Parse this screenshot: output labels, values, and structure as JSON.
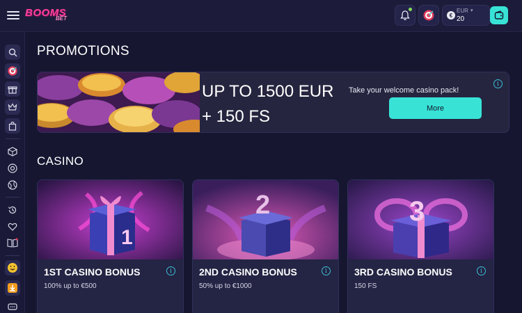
{
  "header": {
    "logo_text": "BOOMS",
    "logo_sub": "BET",
    "currency": "EUR",
    "currency_symbol": "€",
    "balance": "20"
  },
  "sidebar": {
    "items": [
      "search-icon",
      "target-icon",
      "gift-icon",
      "crown-icon",
      "bag-icon",
      "dice-icon",
      "roulette-icon",
      "sports-ball-icon",
      "history-icon",
      "heart-icon",
      "book-icon",
      "emoji-icon",
      "download-icon",
      "chat-icon"
    ]
  },
  "promotions": {
    "title": "PROMOTIONS",
    "heading_line1": "UP TO 1500 EUR",
    "heading_line2": "+ 150 FS",
    "subtitle": "Take your welcome casino pack!",
    "button": "More",
    "info": "i"
  },
  "casino": {
    "title": "CASINO",
    "cards": [
      {
        "title": "1ST CASINO BONUS",
        "desc": "100% up to €500",
        "number": "1",
        "info": "i"
      },
      {
        "title": "2ND CASINO BONUS",
        "desc": "50% up to €1000",
        "number": "2",
        "info": "i"
      },
      {
        "title": "3RD CASINO BONUS",
        "desc": "150 FS",
        "number": "3",
        "info": "i"
      }
    ]
  },
  "colors": {
    "background": "#161631",
    "accent": "#38e3d6",
    "logo": "#ff3f9e"
  }
}
